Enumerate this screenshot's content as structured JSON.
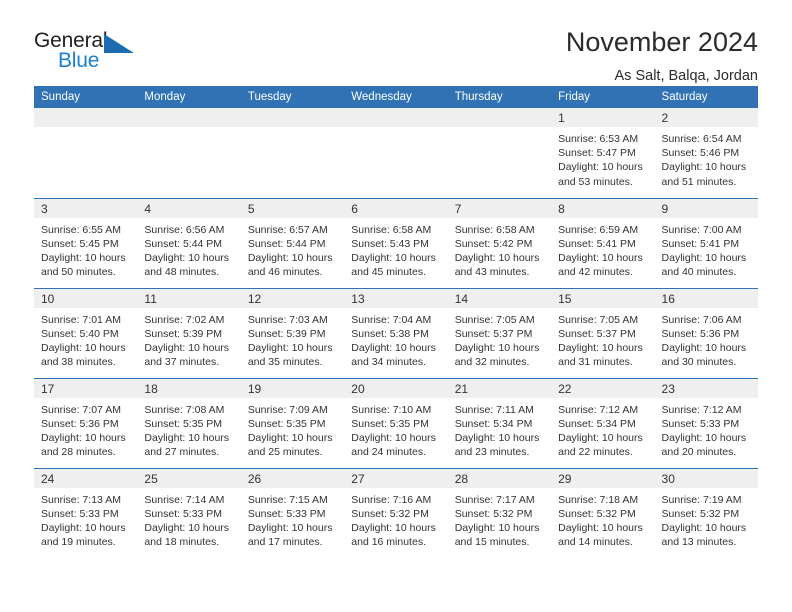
{
  "logo": {
    "primary_text": "General",
    "secondary_text": "Blue",
    "triangle_icon": "triangle-icon",
    "triangle_color": "#1b7fd4"
  },
  "header": {
    "title": "November 2024",
    "subtitle": "As Salt, Balqa, Jordan"
  },
  "theme": {
    "header_blue": "#3072b4",
    "daynum_band": "#efefef",
    "text": "#333333"
  },
  "calendar": {
    "weekday_headers": [
      "Sunday",
      "Monday",
      "Tuesday",
      "Wednesday",
      "Thursday",
      "Friday",
      "Saturday"
    ],
    "weeks": [
      [
        {
          "day": "",
          "empty": true
        },
        {
          "day": "",
          "empty": true
        },
        {
          "day": "",
          "empty": true
        },
        {
          "day": "",
          "empty": true
        },
        {
          "day": "",
          "empty": true
        },
        {
          "day": "1",
          "sunrise": "Sunrise: 6:53 AM",
          "sunset": "Sunset: 5:47 PM",
          "daylight": "Daylight: 10 hours and 53 minutes."
        },
        {
          "day": "2",
          "sunrise": "Sunrise: 6:54 AM",
          "sunset": "Sunset: 5:46 PM",
          "daylight": "Daylight: 10 hours and 51 minutes."
        }
      ],
      [
        {
          "day": "3",
          "sunrise": "Sunrise: 6:55 AM",
          "sunset": "Sunset: 5:45 PM",
          "daylight": "Daylight: 10 hours and 50 minutes."
        },
        {
          "day": "4",
          "sunrise": "Sunrise: 6:56 AM",
          "sunset": "Sunset: 5:44 PM",
          "daylight": "Daylight: 10 hours and 48 minutes."
        },
        {
          "day": "5",
          "sunrise": "Sunrise: 6:57 AM",
          "sunset": "Sunset: 5:44 PM",
          "daylight": "Daylight: 10 hours and 46 minutes."
        },
        {
          "day": "6",
          "sunrise": "Sunrise: 6:58 AM",
          "sunset": "Sunset: 5:43 PM",
          "daylight": "Daylight: 10 hours and 45 minutes."
        },
        {
          "day": "7",
          "sunrise": "Sunrise: 6:58 AM",
          "sunset": "Sunset: 5:42 PM",
          "daylight": "Daylight: 10 hours and 43 minutes."
        },
        {
          "day": "8",
          "sunrise": "Sunrise: 6:59 AM",
          "sunset": "Sunset: 5:41 PM",
          "daylight": "Daylight: 10 hours and 42 minutes."
        },
        {
          "day": "9",
          "sunrise": "Sunrise: 7:00 AM",
          "sunset": "Sunset: 5:41 PM",
          "daylight": "Daylight: 10 hours and 40 minutes."
        }
      ],
      [
        {
          "day": "10",
          "sunrise": "Sunrise: 7:01 AM",
          "sunset": "Sunset: 5:40 PM",
          "daylight": "Daylight: 10 hours and 38 minutes."
        },
        {
          "day": "11",
          "sunrise": "Sunrise: 7:02 AM",
          "sunset": "Sunset: 5:39 PM",
          "daylight": "Daylight: 10 hours and 37 minutes."
        },
        {
          "day": "12",
          "sunrise": "Sunrise: 7:03 AM",
          "sunset": "Sunset: 5:39 PM",
          "daylight": "Daylight: 10 hours and 35 minutes."
        },
        {
          "day": "13",
          "sunrise": "Sunrise: 7:04 AM",
          "sunset": "Sunset: 5:38 PM",
          "daylight": "Daylight: 10 hours and 34 minutes."
        },
        {
          "day": "14",
          "sunrise": "Sunrise: 7:05 AM",
          "sunset": "Sunset: 5:37 PM",
          "daylight": "Daylight: 10 hours and 32 minutes."
        },
        {
          "day": "15",
          "sunrise": "Sunrise: 7:05 AM",
          "sunset": "Sunset: 5:37 PM",
          "daylight": "Daylight: 10 hours and 31 minutes."
        },
        {
          "day": "16",
          "sunrise": "Sunrise: 7:06 AM",
          "sunset": "Sunset: 5:36 PM",
          "daylight": "Daylight: 10 hours and 30 minutes."
        }
      ],
      [
        {
          "day": "17",
          "sunrise": "Sunrise: 7:07 AM",
          "sunset": "Sunset: 5:36 PM",
          "daylight": "Daylight: 10 hours and 28 minutes."
        },
        {
          "day": "18",
          "sunrise": "Sunrise: 7:08 AM",
          "sunset": "Sunset: 5:35 PM",
          "daylight": "Daylight: 10 hours and 27 minutes."
        },
        {
          "day": "19",
          "sunrise": "Sunrise: 7:09 AM",
          "sunset": "Sunset: 5:35 PM",
          "daylight": "Daylight: 10 hours and 25 minutes."
        },
        {
          "day": "20",
          "sunrise": "Sunrise: 7:10 AM",
          "sunset": "Sunset: 5:35 PM",
          "daylight": "Daylight: 10 hours and 24 minutes."
        },
        {
          "day": "21",
          "sunrise": "Sunrise: 7:11 AM",
          "sunset": "Sunset: 5:34 PM",
          "daylight": "Daylight: 10 hours and 23 minutes."
        },
        {
          "day": "22",
          "sunrise": "Sunrise: 7:12 AM",
          "sunset": "Sunset: 5:34 PM",
          "daylight": "Daylight: 10 hours and 22 minutes."
        },
        {
          "day": "23",
          "sunrise": "Sunrise: 7:12 AM",
          "sunset": "Sunset: 5:33 PM",
          "daylight": "Daylight: 10 hours and 20 minutes."
        }
      ],
      [
        {
          "day": "24",
          "sunrise": "Sunrise: 7:13 AM",
          "sunset": "Sunset: 5:33 PM",
          "daylight": "Daylight: 10 hours and 19 minutes."
        },
        {
          "day": "25",
          "sunrise": "Sunrise: 7:14 AM",
          "sunset": "Sunset: 5:33 PM",
          "daylight": "Daylight: 10 hours and 18 minutes."
        },
        {
          "day": "26",
          "sunrise": "Sunrise: 7:15 AM",
          "sunset": "Sunset: 5:33 PM",
          "daylight": "Daylight: 10 hours and 17 minutes."
        },
        {
          "day": "27",
          "sunrise": "Sunrise: 7:16 AM",
          "sunset": "Sunset: 5:32 PM",
          "daylight": "Daylight: 10 hours and 16 minutes."
        },
        {
          "day": "28",
          "sunrise": "Sunrise: 7:17 AM",
          "sunset": "Sunset: 5:32 PM",
          "daylight": "Daylight: 10 hours and 15 minutes."
        },
        {
          "day": "29",
          "sunrise": "Sunrise: 7:18 AM",
          "sunset": "Sunset: 5:32 PM",
          "daylight": "Daylight: 10 hours and 14 minutes."
        },
        {
          "day": "30",
          "sunrise": "Sunrise: 7:19 AM",
          "sunset": "Sunset: 5:32 PM",
          "daylight": "Daylight: 10 hours and 13 minutes."
        }
      ]
    ]
  }
}
